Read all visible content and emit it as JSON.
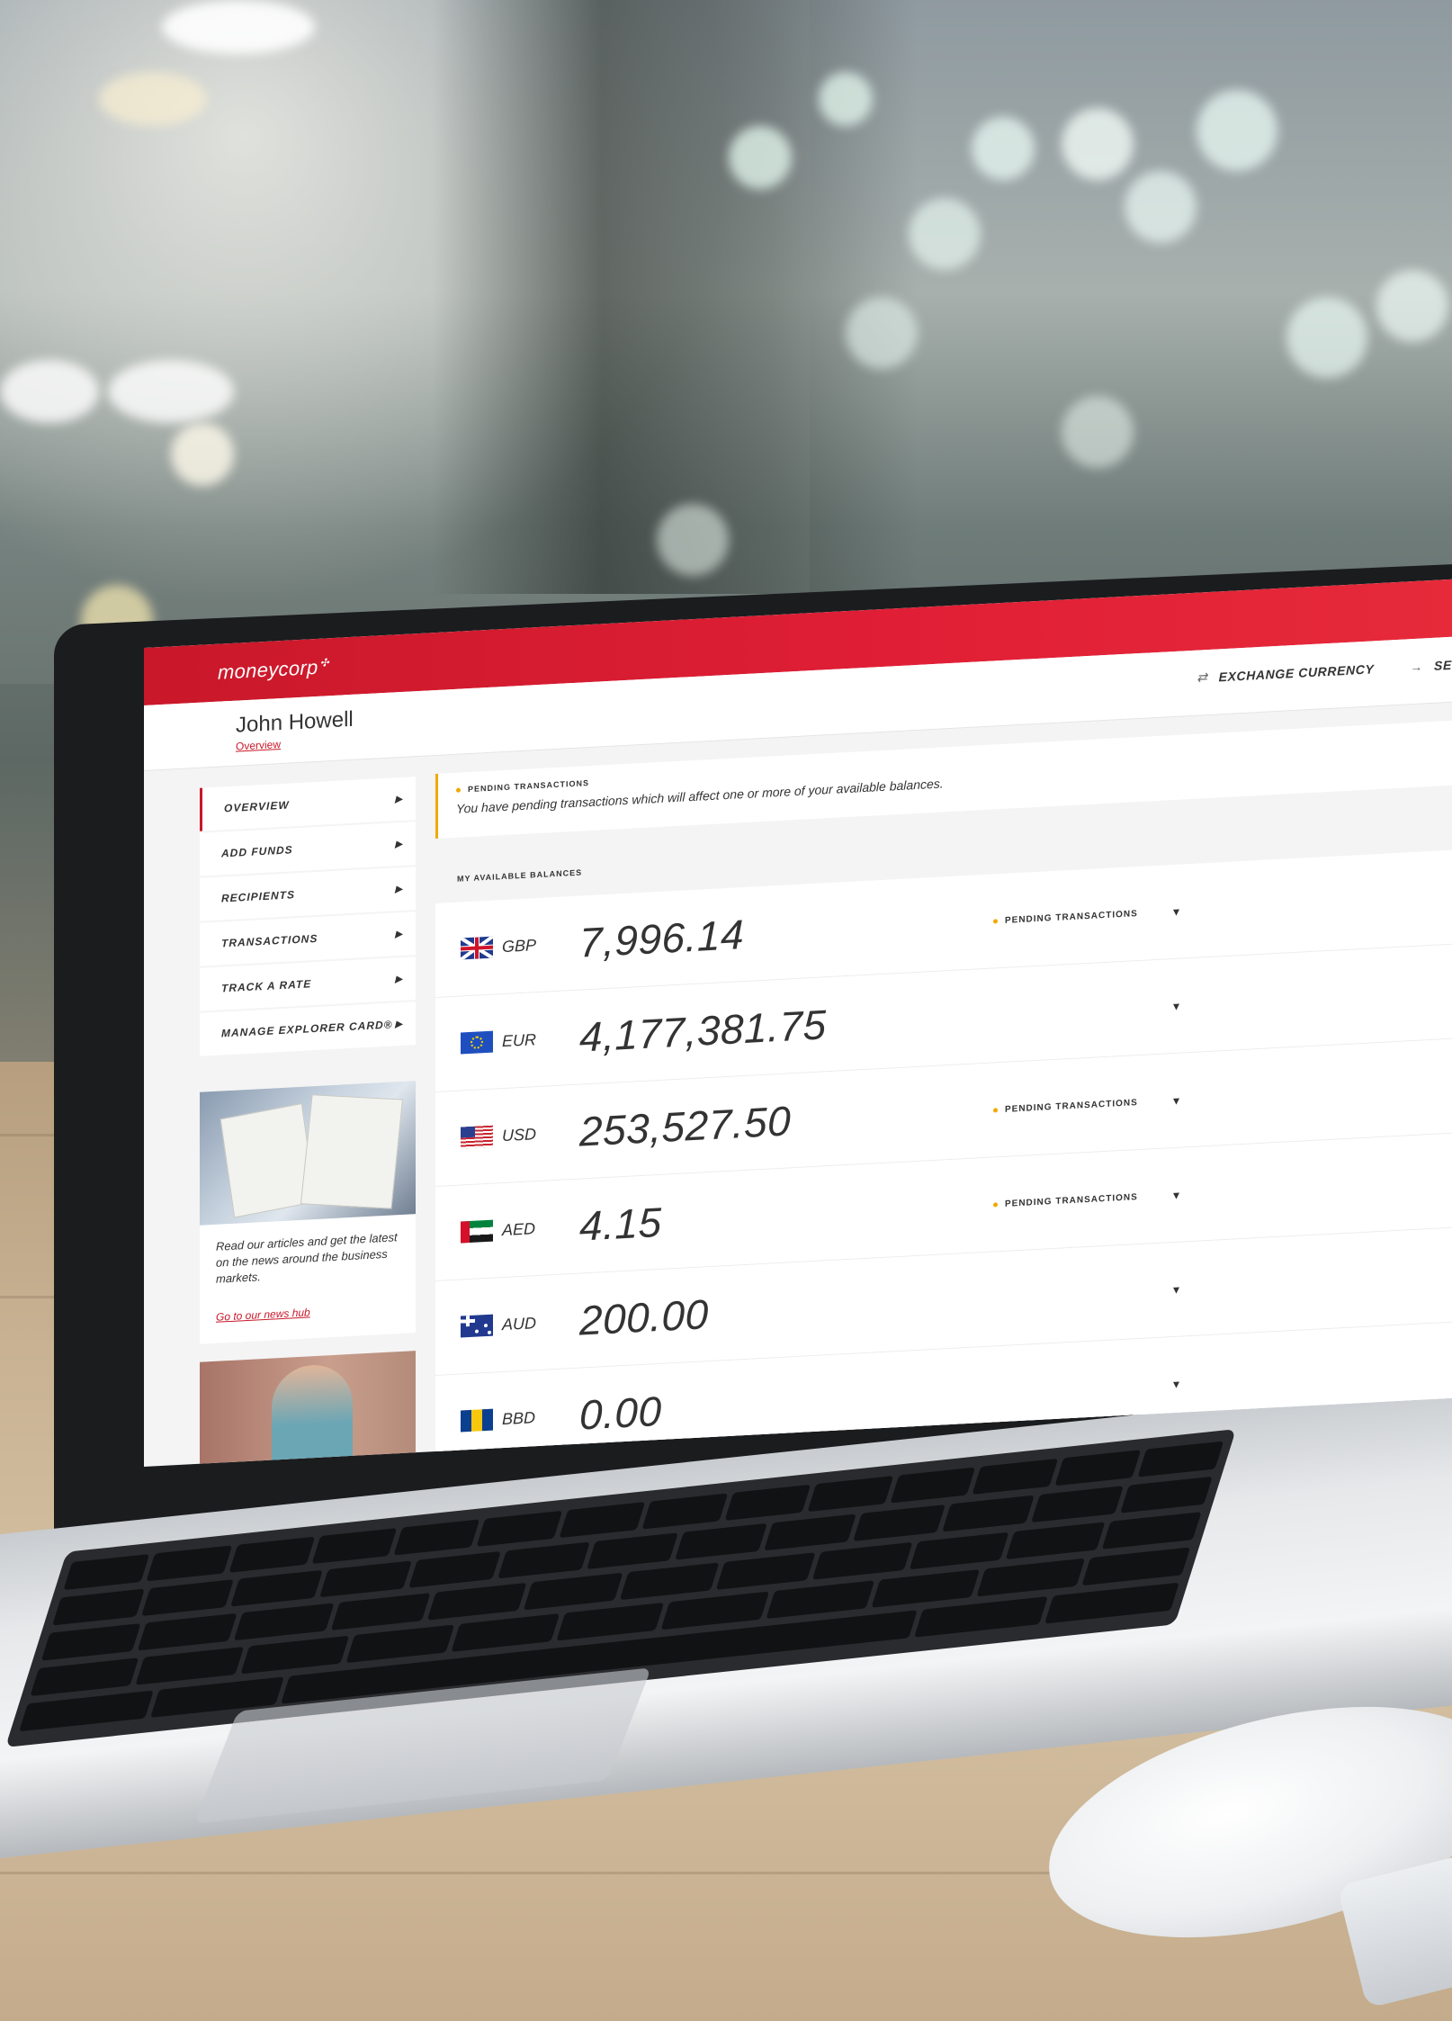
{
  "app": {
    "logo": "moneycorp"
  },
  "header": {
    "user_name": "John Howell",
    "breadcrumb": "Overview",
    "actions": [
      {
        "label": "EXCHANGE CURRENCY",
        "icon": "exchange-icon"
      },
      {
        "label": "SEND A",
        "icon": "arrow-right-icon"
      }
    ]
  },
  "sidebar": {
    "items": [
      {
        "label": "OVERVIEW",
        "active": true
      },
      {
        "label": "ADD FUNDS"
      },
      {
        "label": "RECIPIENTS"
      },
      {
        "label": "TRANSACTIONS"
      },
      {
        "label": "TRACK A RATE"
      },
      {
        "label": "MANAGE EXPLORER CARD®"
      }
    ],
    "promo": {
      "text": "Read our articles and get the latest on the news around the business markets.",
      "link": "Go to our news hub"
    }
  },
  "main": {
    "notice": {
      "title": "PENDING TRANSACTIONS",
      "message": "You have pending transactions which will affect one or more of your available balances."
    },
    "balances_title": "MY AVAILABLE BALANCES",
    "balances": [
      {
        "code": "GBP",
        "amount": "7,996.14",
        "pending": "PENDING TRANSACTIONS",
        "flag": "gbp-flag-icon"
      },
      {
        "code": "EUR",
        "amount": "4,177,381.75",
        "pending": "",
        "flag": "eur-flag-icon"
      },
      {
        "code": "USD",
        "amount": "253,527.50",
        "pending": "PENDING TRANSACTIONS",
        "flag": "usd-flag-icon"
      },
      {
        "code": "AED",
        "amount": "4.15",
        "pending": "PENDING TRANSACTIONS",
        "flag": "aed-flag-icon"
      },
      {
        "code": "AUD",
        "amount": "200.00",
        "pending": "",
        "flag": "aud-flag-icon"
      },
      {
        "code": "BBD",
        "amount": "0.00",
        "pending": "",
        "flag": "bbd-flag-icon"
      }
    ]
  },
  "colors": {
    "brand_red": "#c9182a",
    "pending_amber": "#f2a900"
  }
}
